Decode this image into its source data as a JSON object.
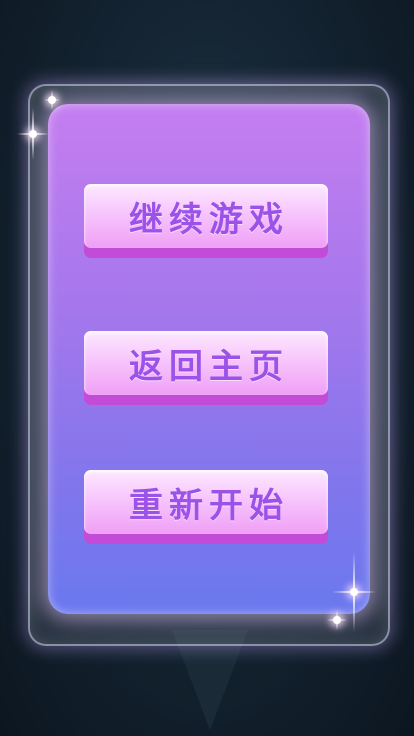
{
  "menu": {
    "buttons": [
      {
        "label": "继续游戏"
      },
      {
        "label": "返回主页"
      },
      {
        "label": "重新开始"
      }
    ]
  },
  "colors": {
    "background": "#152533",
    "panel_top": "#c47ef0",
    "panel_bottom": "#6a78ee",
    "button_face": "#f7c6fc",
    "button_shadow": "#c24cd8",
    "button_text": "#9b52e8"
  }
}
